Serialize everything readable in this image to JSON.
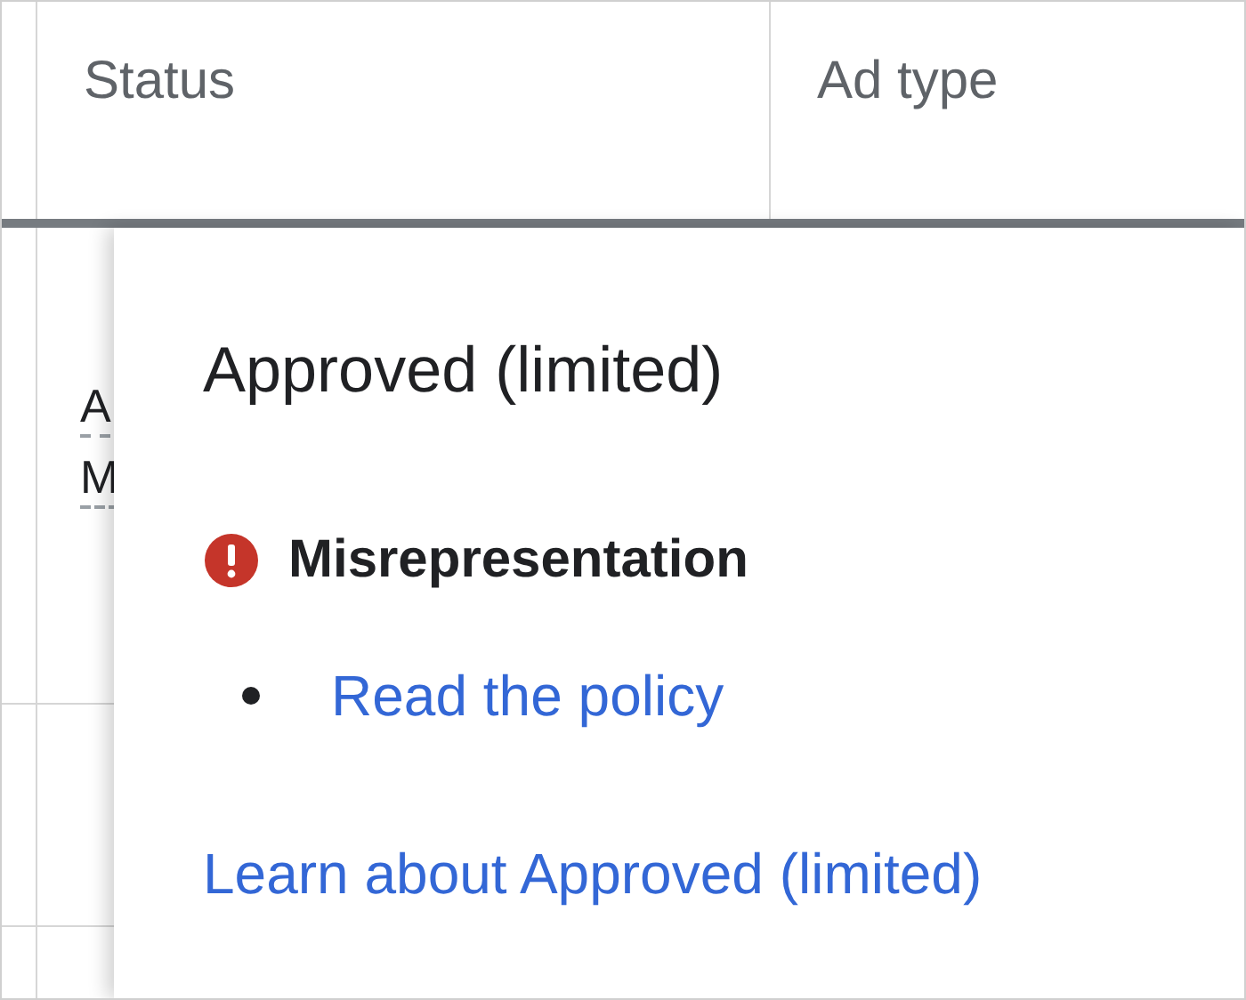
{
  "table": {
    "columns": [
      "Status",
      "Ad type"
    ],
    "row_text": [
      "A",
      "M"
    ]
  },
  "popover": {
    "title": "Approved (limited)",
    "issues": [
      {
        "kind": "error",
        "label": "Misrepresentation",
        "links": [
          "Read the policy"
        ]
      }
    ],
    "footer_link": "Learn about Approved (limited)"
  }
}
